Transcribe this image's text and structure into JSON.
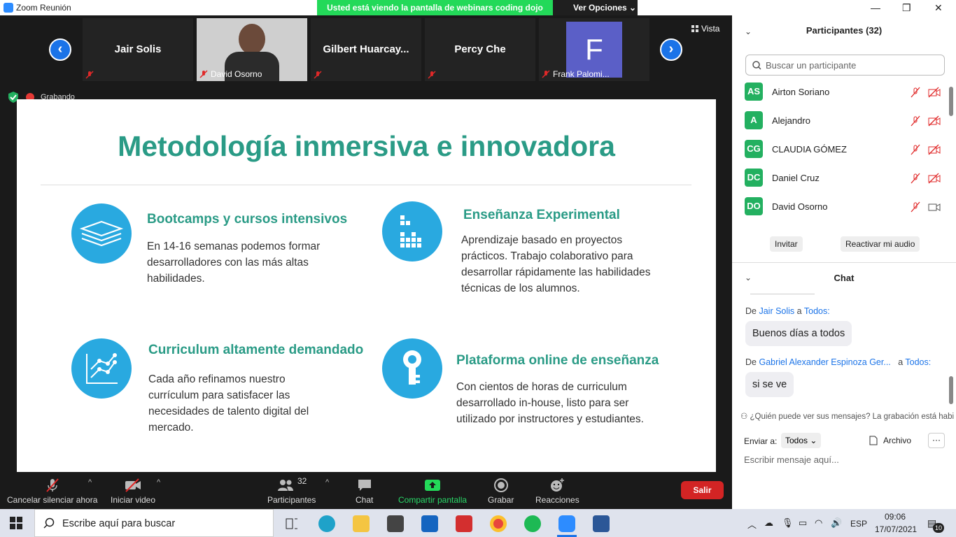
{
  "window": {
    "title": "Zoom Reunión",
    "share_banner": "Usted está viendo la pantalla de webinars coding dojo",
    "view_options": "Ver Opciones",
    "view_mode": "Vista"
  },
  "gallery": {
    "tiles": [
      {
        "name": "Jair Solis",
        "footer": ""
      },
      {
        "name": "",
        "footer": "David Osorno"
      },
      {
        "name": "Gilbert  Huarcay...",
        "footer": ""
      },
      {
        "name": "Percy Che",
        "footer": ""
      },
      {
        "name": "",
        "footer": "Frank Palomi...",
        "avatar_letter": "F"
      }
    ],
    "recording": "Grabando"
  },
  "slide": {
    "title": "Metodología inmersiva e innovadora",
    "features": [
      {
        "title": "Bootcamps y cursos intensivos",
        "body": "En 14-16 semanas podemos formar desarrolladores con las más altas habilidades.",
        "icon": "layers-icon"
      },
      {
        "title": "Enseñanza Experimental",
        "body": "Aprendizaje basado en proyectos prácticos. Trabajo colaborativo para desarrollar rápidamente las habilidades técnicas de los alumnos.",
        "icon": "blocks-icon"
      },
      {
        "title": "Curriculum altamente demandado",
        "body": "Cada año refinamos nuestro currículum para satisfacer las necesidades de talento digital del mercado.",
        "icon": "chart-icon"
      },
      {
        "title": "Plataforma online de enseñanza",
        "body": "Con cientos de horas de curriculum desarrollado in-house, listo para ser utilizado por instructores y estudiantes.",
        "icon": "key-icon"
      }
    ]
  },
  "participants": {
    "header": "Participantes (32)",
    "search_placeholder": "Buscar un participante",
    "list": [
      {
        "initials": "AS",
        "name": "Airton Soriano"
      },
      {
        "initials": "A",
        "name": "Alejandro"
      },
      {
        "initials": "CG",
        "name": "CLAUDIA GÓMEZ"
      },
      {
        "initials": "DC",
        "name": "Daniel Cruz"
      },
      {
        "initials": "DO",
        "name": "David Osorno"
      }
    ],
    "invite": "Invitar",
    "unmute": "Reactivar mi audio"
  },
  "chat": {
    "header": "Chat",
    "messages": [
      {
        "from_prefix": "De",
        "from": "Jair Solis",
        "to_prefix": "a",
        "to": "Todos:",
        "text": "Buenos días a todos"
      },
      {
        "from_prefix": "De",
        "from": "Gabriel Alexander Espinoza Ger...",
        "to_prefix": "a",
        "to": "Todos:",
        "text": "si se ve"
      }
    ],
    "notice": "¿Quién puede ver sus mensajes? La grabación está habilit",
    "send_to_label": "Enviar a:",
    "send_to": "Todos",
    "file": "Archivo",
    "more": "···",
    "input_placeholder": "Escribir mensaje aquí..."
  },
  "toolbar": {
    "mute": "Cancelar silenciar ahora",
    "video": "Iniciar video",
    "participants": "Participantes",
    "participants_count": "32",
    "chat": "Chat",
    "share": "Compartir pantalla",
    "record": "Grabar",
    "reactions": "Reacciones",
    "leave": "Salir"
  },
  "taskbar": {
    "search": "Escribe aquí para buscar",
    "lang": "ESP",
    "time": "09:06",
    "date": "17/07/2021",
    "notifications": "10"
  }
}
